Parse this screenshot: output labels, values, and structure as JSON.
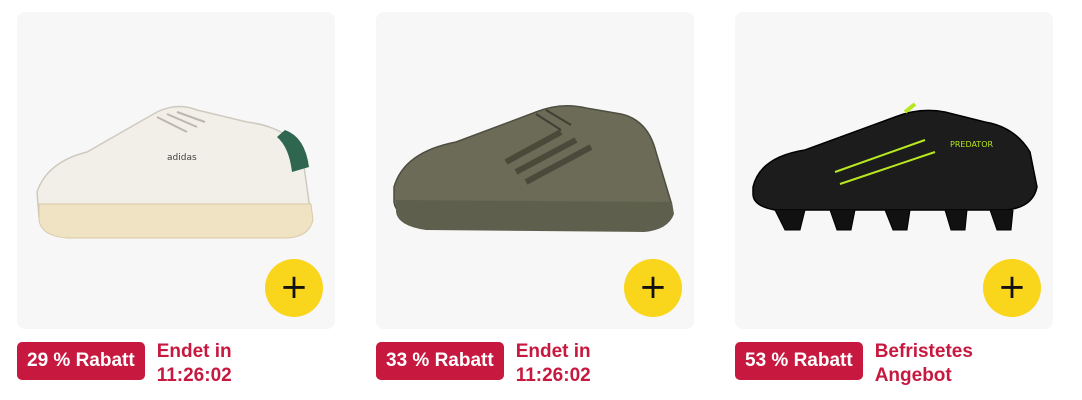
{
  "colors": {
    "badge_bg": "#c7193f",
    "deal_text": "#c7193f",
    "add_button": "#f9d51c",
    "tile_bg": "#f7f7f7"
  },
  "products": [
    {
      "add_icon": "plus-icon",
      "add_symbol": "+",
      "discount": "29 % Rabatt",
      "deal_line1": "Endet in",
      "deal_line2": "11:26:02"
    },
    {
      "add_icon": "plus-icon",
      "add_symbol": "+",
      "discount": "33 % Rabatt",
      "deal_line1": "Endet in",
      "deal_line2": "11:26:02"
    },
    {
      "add_icon": "plus-icon",
      "add_symbol": "+",
      "discount": "53 % Rabatt",
      "deal_line1": "Befristetes",
      "deal_line2": "Angebot"
    }
  ]
}
